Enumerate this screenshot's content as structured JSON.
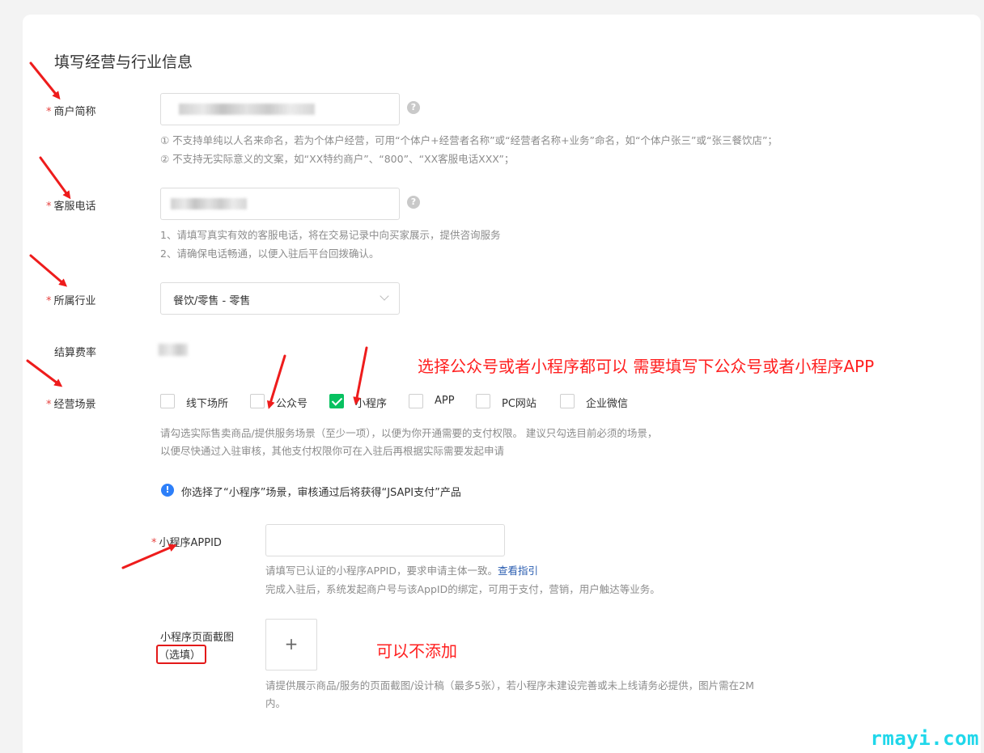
{
  "section_title": "填写经营与行业信息",
  "required_mark": "*",
  "merchant_name": {
    "label": "商户简称",
    "help": "?",
    "hints": [
      "① 不支持单纯以人名来命名，若为个体户经营，可用“个体户+经营者名称”或“经营者名称+业务”命名，如“个体户张三”或“张三餐饮店”；",
      "② 不支持无实际意义的文案，如“XX特约商户”、“800”、“XX客服电话XXX”；"
    ]
  },
  "service_phone": {
    "label": "客服电话",
    "help": "?",
    "hints": [
      "1、请填写真实有效的客服电话，将在交易记录中向买家展示，提供咨询服务",
      "2、请确保电话畅通，以便入驻后平台回拨确认。"
    ]
  },
  "industry": {
    "label": "所属行业",
    "value": "餐饮/零售 - 零售"
  },
  "settlement_rate": {
    "label": "结算费率"
  },
  "scenarios": {
    "label": "经营场景",
    "options": [
      {
        "label": "线下场所",
        "checked": false
      },
      {
        "label": "公众号",
        "checked": false
      },
      {
        "label": "小程序",
        "checked": true
      },
      {
        "label": "APP",
        "checked": false
      },
      {
        "label": "PC网站",
        "checked": false
      },
      {
        "label": "企业微信",
        "checked": false
      }
    ],
    "hints": [
      "请勾选实际售卖商品/提供服务场景（至少一项），以便为你开通需要的支付权限。 建议只勾选目前必须的场景，",
      "以便尽快通过入驻审核，其他支付权限你可在入驻后再根据实际需要发起申请"
    ],
    "notice": "你选择了“小程序”场景，审核通过后将获得“JSAPI支付”产品"
  },
  "mini_appid": {
    "label": "小程序APPID",
    "value": "",
    "hint_text": "请填写已认证的小程序APPID，要求申请主体一致。",
    "hint_link": "查看指引",
    "hint_line2": "完成入驻后，系统发起商户号与该AppID的绑定，可用于支付，营销，用户触达等业务。"
  },
  "mini_screenshot": {
    "label": "小程序页面截图",
    "optional": "（选填）",
    "upload_symbol": "+",
    "hints": [
      "请提供展示商品/服务的页面截图/设计稿（最多5张），若小程序未建设完善或未上线请务必提供，图片需在2M",
      "内。"
    ]
  },
  "annotations": {
    "scenario_note": "选择公众号或者小程序都可以 需要填写下公众号或者小程序APP",
    "screenshot_note": "可以不添加"
  },
  "watermark": "rmayi.com",
  "colors": {
    "accent_green": "#07c160",
    "required_red": "#e64340",
    "annotation_red": "#ff1f1f",
    "info_blue": "#2d7ff9",
    "watermark": "#20d7ea"
  }
}
